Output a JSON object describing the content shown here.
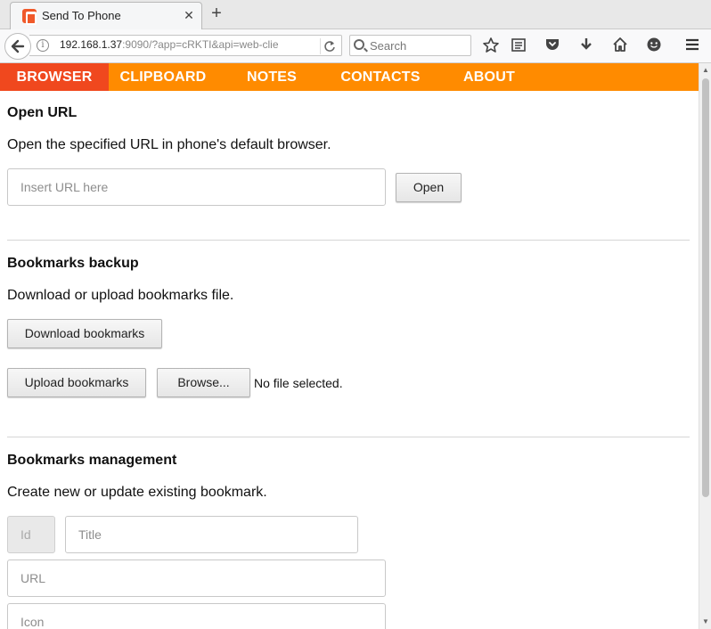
{
  "browser": {
    "tab": {
      "title": "Send To Phone",
      "close_glyph": "✕"
    },
    "newtab_glyph": "+",
    "url": {
      "host": "192.168.1.37",
      "rest": ":9090/?app=cRKTI&api=web-clie"
    },
    "search": {
      "placeholder": "Search"
    },
    "icons": [
      "back-arrow-icon",
      "info-icon",
      "reload-icon",
      "search-icon",
      "bookmark-star-icon",
      "reading-list-icon",
      "pocket-icon",
      "download-icon",
      "home-icon",
      "smiley-icon",
      "hamburger-menu-icon"
    ]
  },
  "menu": {
    "items": [
      {
        "label": "BROWSER",
        "active": true
      },
      {
        "label": "CLIPBOARD",
        "active": false
      },
      {
        "label": "NOTES",
        "active": false
      },
      {
        "label": "CONTACTS",
        "active": false
      },
      {
        "label": "ABOUT",
        "active": false
      }
    ]
  },
  "open_url": {
    "title": "Open URL",
    "description": "Open the specified URL in phone's default browser.",
    "input_placeholder": "Insert URL here",
    "button": "Open"
  },
  "bookmarks_backup": {
    "title": "Bookmarks backup",
    "description": "Download or upload bookmarks file.",
    "download_button": "Download bookmarks",
    "upload_button": "Upload bookmarks",
    "browse_button": "Browse...",
    "file_status": "No file selected."
  },
  "bookmarks_management": {
    "title": "Bookmarks management",
    "description": "Create new or update existing bookmark.",
    "id_placeholder": "Id",
    "title_placeholder": "Title",
    "url_placeholder": "URL",
    "icon_placeholder": "Icon"
  },
  "colors": {
    "menu_bg": "#ff8b00",
    "menu_active_bg": "#f0481e",
    "favicon": "#f0592a"
  }
}
